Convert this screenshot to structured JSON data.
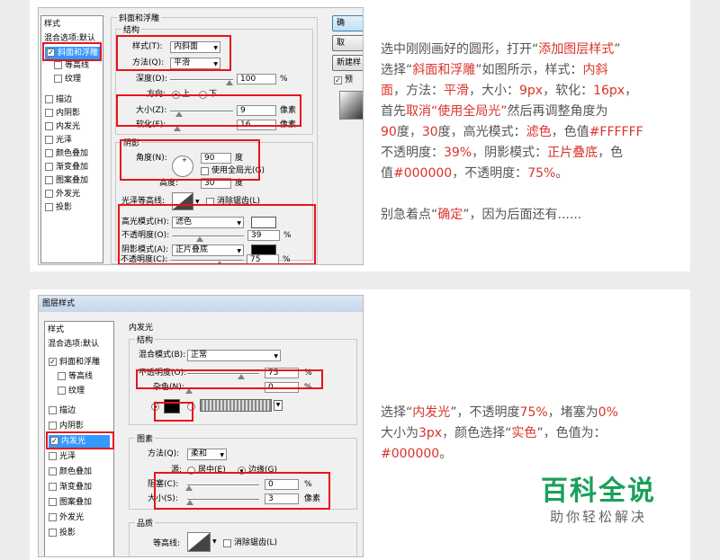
{
  "panel1": {
    "stylelist": {
      "header": "样式",
      "blend": "混合选项:默认",
      "items": [
        "斜面和浮雕",
        "等高线",
        "纹理",
        "描边",
        "内阴影",
        "内发光",
        "光泽",
        "颜色叠加",
        "渐变叠加",
        "图案叠加",
        "外发光",
        "投影"
      ]
    },
    "group_title": "斜面和浮雕",
    "structure_title": "结构",
    "style_label": "样式(T):",
    "style_value": "内斜面",
    "method_label": "方法(Q):",
    "method_value": "平滑",
    "depth_label": "深度(D):",
    "depth_value": "100",
    "pct": "%",
    "direction_label": "方向:",
    "dir_up": "上",
    "dir_down": "下",
    "size_label": "大小(Z):",
    "size_value": "9",
    "px": "像素",
    "soften_label": "软化(F):",
    "soften_value": "16",
    "shadow_title": "阴影",
    "angle_label": "角度(N):",
    "angle_value": "90",
    "deg": "度",
    "global_light": "使用全局光(G)",
    "altitude_label": "高度:",
    "altitude_value": "30",
    "gloss_label": "光泽等高线:",
    "antialias": "消除锯齿(L)",
    "highlight_label": "高光模式(H):",
    "highlight_value": "滤色",
    "hl_opacity_label": "不透明度(O):",
    "hl_opacity_value": "39",
    "shadow_mode_label": "阴影模式(A):",
    "shadow_mode_value": "正片叠底",
    "sh_opacity_label": "不透明度(C):",
    "sh_opacity_value": "75",
    "btn_ok": "确",
    "btn_cancel": "取",
    "btn_new": "新建样",
    "btn_preview": "预",
    "description": {
      "l1a": "选中刚刚画好的圆形，打开“",
      "l1b": "添加图层样式",
      "l1c": "”",
      "l2a": "选择“",
      "l2b": "斜面和浮雕",
      "l2c": "”如图所示，样式：",
      "l2d": "内斜",
      "l3a": "面",
      "l3b": "，方法：",
      "l3c": "平滑",
      "l3d": "，大小：",
      "l3e": "9px",
      "l3f": "，软化：",
      "l3g": "16px",
      "l3h": "，",
      "l4a": "首先",
      "l4b": "取消“使用全局光”",
      "l4c": "然后再调整角度为",
      "l5a": "90",
      "l5b": "度，",
      "l5c": "30",
      "l5d": "度，高光模式：",
      "l5e": "滤色",
      "l5f": "，色值",
      "l5g": "#FFFFFF",
      "l6a": "不透明度：",
      "l6b": "39%",
      "l6c": "，阴影模式：",
      "l6d": "正片叠底",
      "l6e": "，色",
      "l7a": "值",
      "l7b": "#000000",
      "l7c": "，不透明度：",
      "l7d": "75%",
      "l7e": "。",
      "l8a": "别急着点“",
      "l8b": "确定",
      "l8c": "”，因为后面还有......"
    }
  },
  "panel2": {
    "window_title": "图层样式",
    "stylelist": {
      "header": "样式",
      "blend": "混合选项:默认",
      "items": [
        "斜面和浮雕",
        "等高线",
        "纹理",
        "描边",
        "内阴影",
        "内发光",
        "光泽",
        "颜色叠加",
        "渐变叠加",
        "图案叠加",
        "外发光",
        "投影"
      ]
    },
    "group_title": "内发光",
    "structure_title": "结构",
    "blend_mode_label": "混合模式(B):",
    "blend_mode_value": "正常",
    "opacity_label": "不透明度(O):",
    "opacity_value": "75",
    "noise_label": "杂色(N):",
    "noise_value": "0",
    "pct": "%",
    "elements_title": "图素",
    "method_label": "方法(Q):",
    "method_value": "柔和",
    "source_label": "源:",
    "source_center": "居中(E)",
    "source_edge": "边缘(G)",
    "choke_label": "阻塞(C):",
    "choke_value": "0",
    "size_label": "大小(S):",
    "size_value": "3",
    "px": "像素",
    "quality_title": "品质",
    "contour_label": "等高线:",
    "antialias": "消除锯齿(L)",
    "description": {
      "l1a": "选择“",
      "l1b": "内发光",
      "l1c": "”，不透明度",
      "l1d": "75%",
      "l1e": "，堵塞为",
      "l1f": "0%",
      "l2a": "大小为",
      "l2b": "3px",
      "l2c": "，颜色选择“",
      "l2d": "实色",
      "l2e": "”，色值为：",
      "l3a": "#000000",
      "l3b": "。"
    },
    "watermark_main": "百科全说",
    "watermark_sub": "助你轻松解决"
  },
  "colors": {
    "highlight": "#e8141b",
    "accent_text": "#d9342b",
    "watermark": "#1aa05a"
  }
}
